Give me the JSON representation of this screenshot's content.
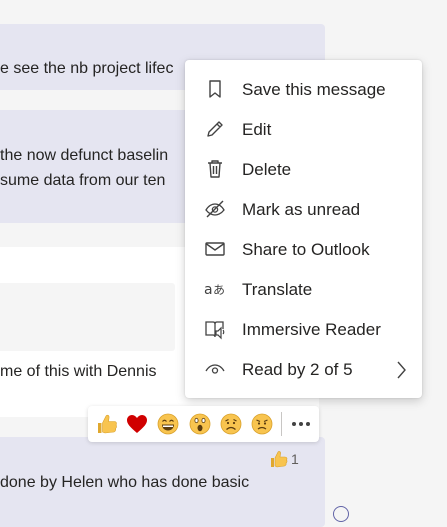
{
  "messages": [
    {
      "text": "e see the nb project lifec"
    },
    {
      "line1": " the now defunct baselin",
      "line2": "sume data from our ten"
    },
    {
      "text": "me of this with Dennis"
    },
    {
      "text": "done by Helen who has done basic"
    }
  ],
  "context_menu": {
    "items": [
      {
        "label": "Save this message",
        "icon": "bookmark-icon"
      },
      {
        "label": "Edit",
        "icon": "pencil-icon"
      },
      {
        "label": "Delete",
        "icon": "trash-icon"
      },
      {
        "label": "Mark as unread",
        "icon": "eye-off-icon"
      },
      {
        "label": "Share to Outlook",
        "icon": "mail-icon"
      },
      {
        "label": "Translate",
        "icon": "translate-icon"
      },
      {
        "label": "Immersive Reader",
        "icon": "immersive-reader-icon"
      },
      {
        "label": "Read by 2 of 5",
        "icon": "eye-icon",
        "submenu_icon": "chevron-right-icon"
      }
    ]
  },
  "reactions": {
    "items": [
      "like",
      "heart",
      "laugh",
      "surprised",
      "sad",
      "angry"
    ],
    "more_icon": "more-options-icon"
  },
  "like_reaction": {
    "count": "1",
    "icon": "thumbs-up-icon"
  },
  "colors": {
    "bubble": "#e5e5f1",
    "menu_bg": "#ffffff",
    "accent": "#6264a7",
    "heart": "#d00000",
    "emoji": "#f8c44f"
  }
}
